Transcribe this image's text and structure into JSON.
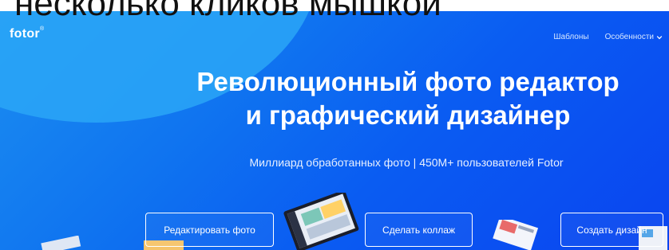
{
  "overlay_text": "несколько кликов мышкой",
  "header": {
    "logo": "fotor",
    "logo_mark": "®",
    "nav": [
      {
        "label": "Шаблоны"
      },
      {
        "label": "Особенности"
      }
    ]
  },
  "hero": {
    "title_line1": "Революционный фото редактор",
    "title_line2": "и графический дизайнер",
    "subtitle": "Миллиард обработанных фото | 450M+ пользователей Fotor"
  },
  "buttons": {
    "edit": "Редактировать фото",
    "collage": "Сделать коллаж",
    "design": "Создать дизайн"
  },
  "icons": {
    "dropdown": "chevron-down-icon"
  },
  "colors": {
    "hero_blue": "#0f73f0",
    "hero_light": "#2aa6f7",
    "button_border": "#ffffff"
  }
}
